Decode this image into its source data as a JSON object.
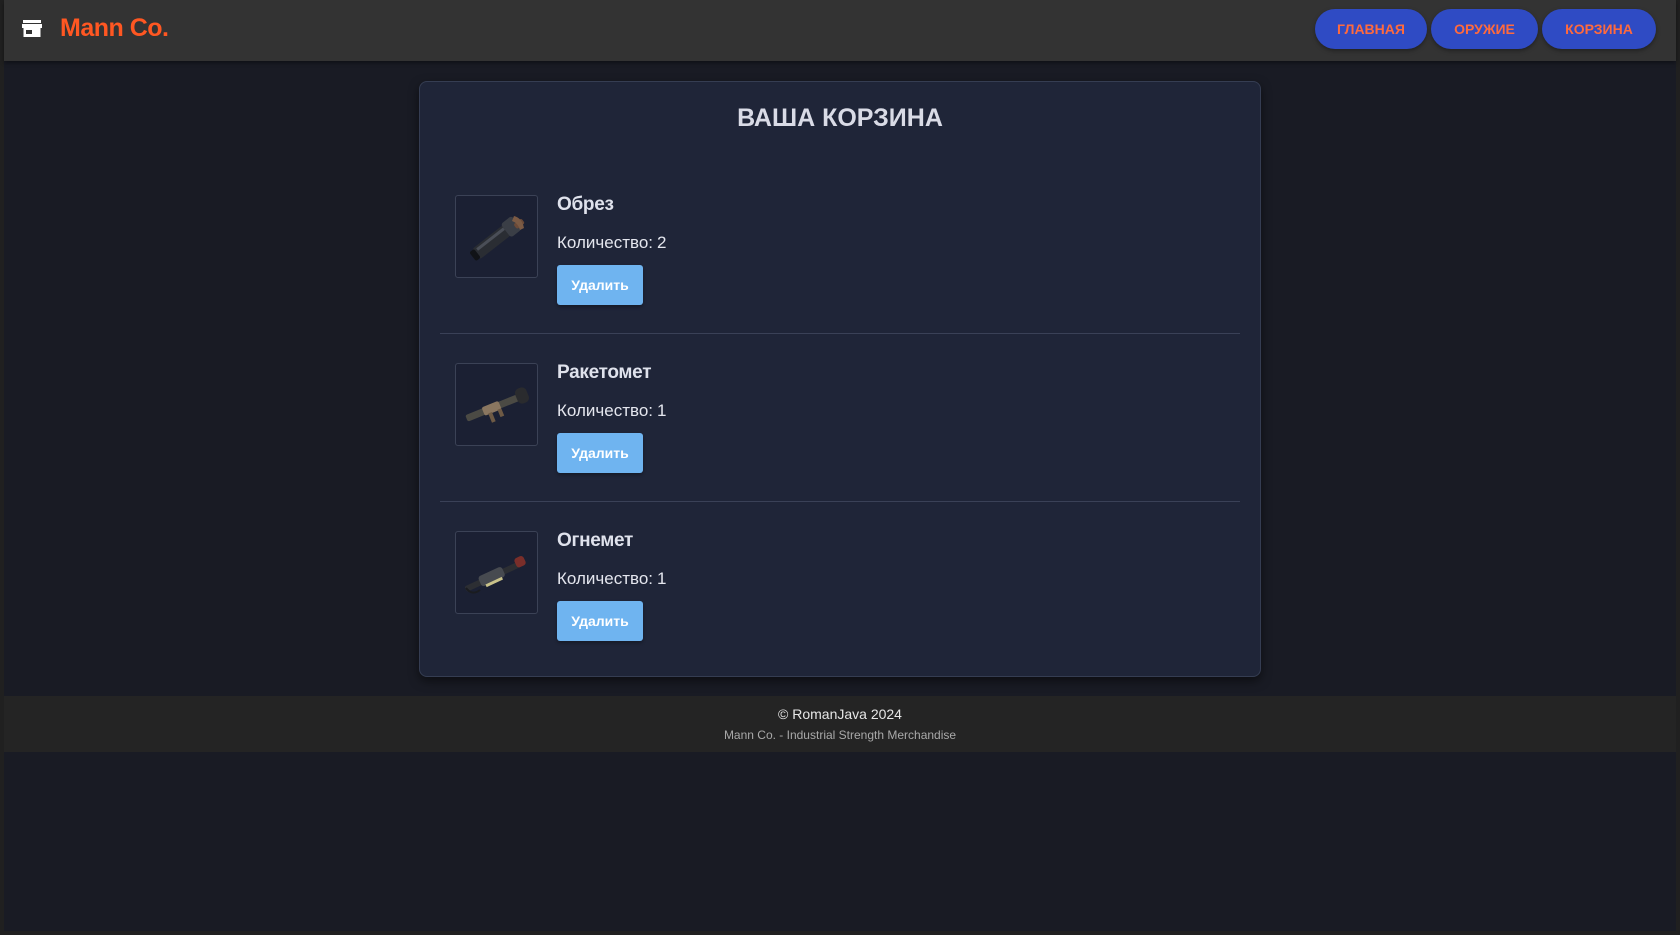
{
  "header": {
    "brand": "Mann Co.",
    "logo_icon": "storefront-icon",
    "nav": [
      {
        "label": "ГЛАВНАЯ"
      },
      {
        "label": "ОРУЖИЕ"
      },
      {
        "label": "КОРЗИНА"
      }
    ]
  },
  "cart": {
    "title": "ВАША КОРЗИНА",
    "quantity_label": "Количество:",
    "remove_label": "Удалить",
    "items": [
      {
        "name": "Обрез",
        "quantity": "2",
        "image": "sawed-off-shotgun-image"
      },
      {
        "name": "Ракетомет",
        "quantity": "1",
        "image": "rocket-launcher-image"
      },
      {
        "name": "Огнемет",
        "quantity": "1",
        "image": "flamethrower-image"
      }
    ]
  },
  "footer": {
    "copyright": "© RomanJava 2024",
    "tagline": "Mann Co. - Industrial Strength Merchandise"
  },
  "colors": {
    "brand": "#ff5722",
    "nav_button_bg": "#2f4bc4",
    "nav_button_text": "#ff6a3d",
    "remove_button_bg": "#6fb4f0",
    "card_bg": "#1f2538",
    "page_bg": "#191b24"
  }
}
